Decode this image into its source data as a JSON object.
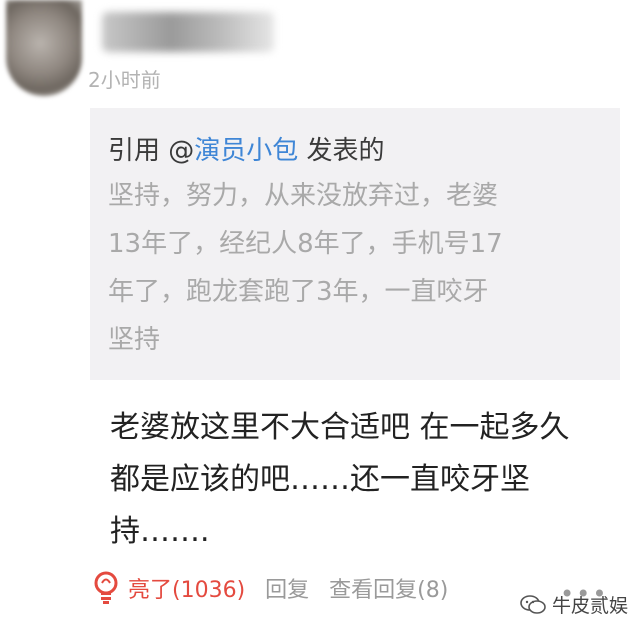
{
  "post": {
    "time": "2小时前"
  },
  "quote": {
    "prefix": "引用 @",
    "author": "演员小包",
    "suffix": " 发表的",
    "lines": [
      "坚持，努力，从来没放弃过，老婆",
      "13年了，经纪人8年了，手机号17",
      "年了，跑龙套跑了3年，一直咬牙",
      "坚持"
    ]
  },
  "comment": {
    "lines": [
      "老婆放这里不大合适吧 在一起多久",
      "都是应该的吧……还一直咬牙坚",
      "持……."
    ]
  },
  "actions": {
    "like": "亮了(1036)",
    "reply": "回复",
    "view_replies": "查看回复(8)",
    "more": "•••"
  },
  "watermark": {
    "text": "牛皮贰娱"
  },
  "colors": {
    "link": "#3f86d6",
    "like": "#e44a3f",
    "muted": "#9a9a9a"
  }
}
